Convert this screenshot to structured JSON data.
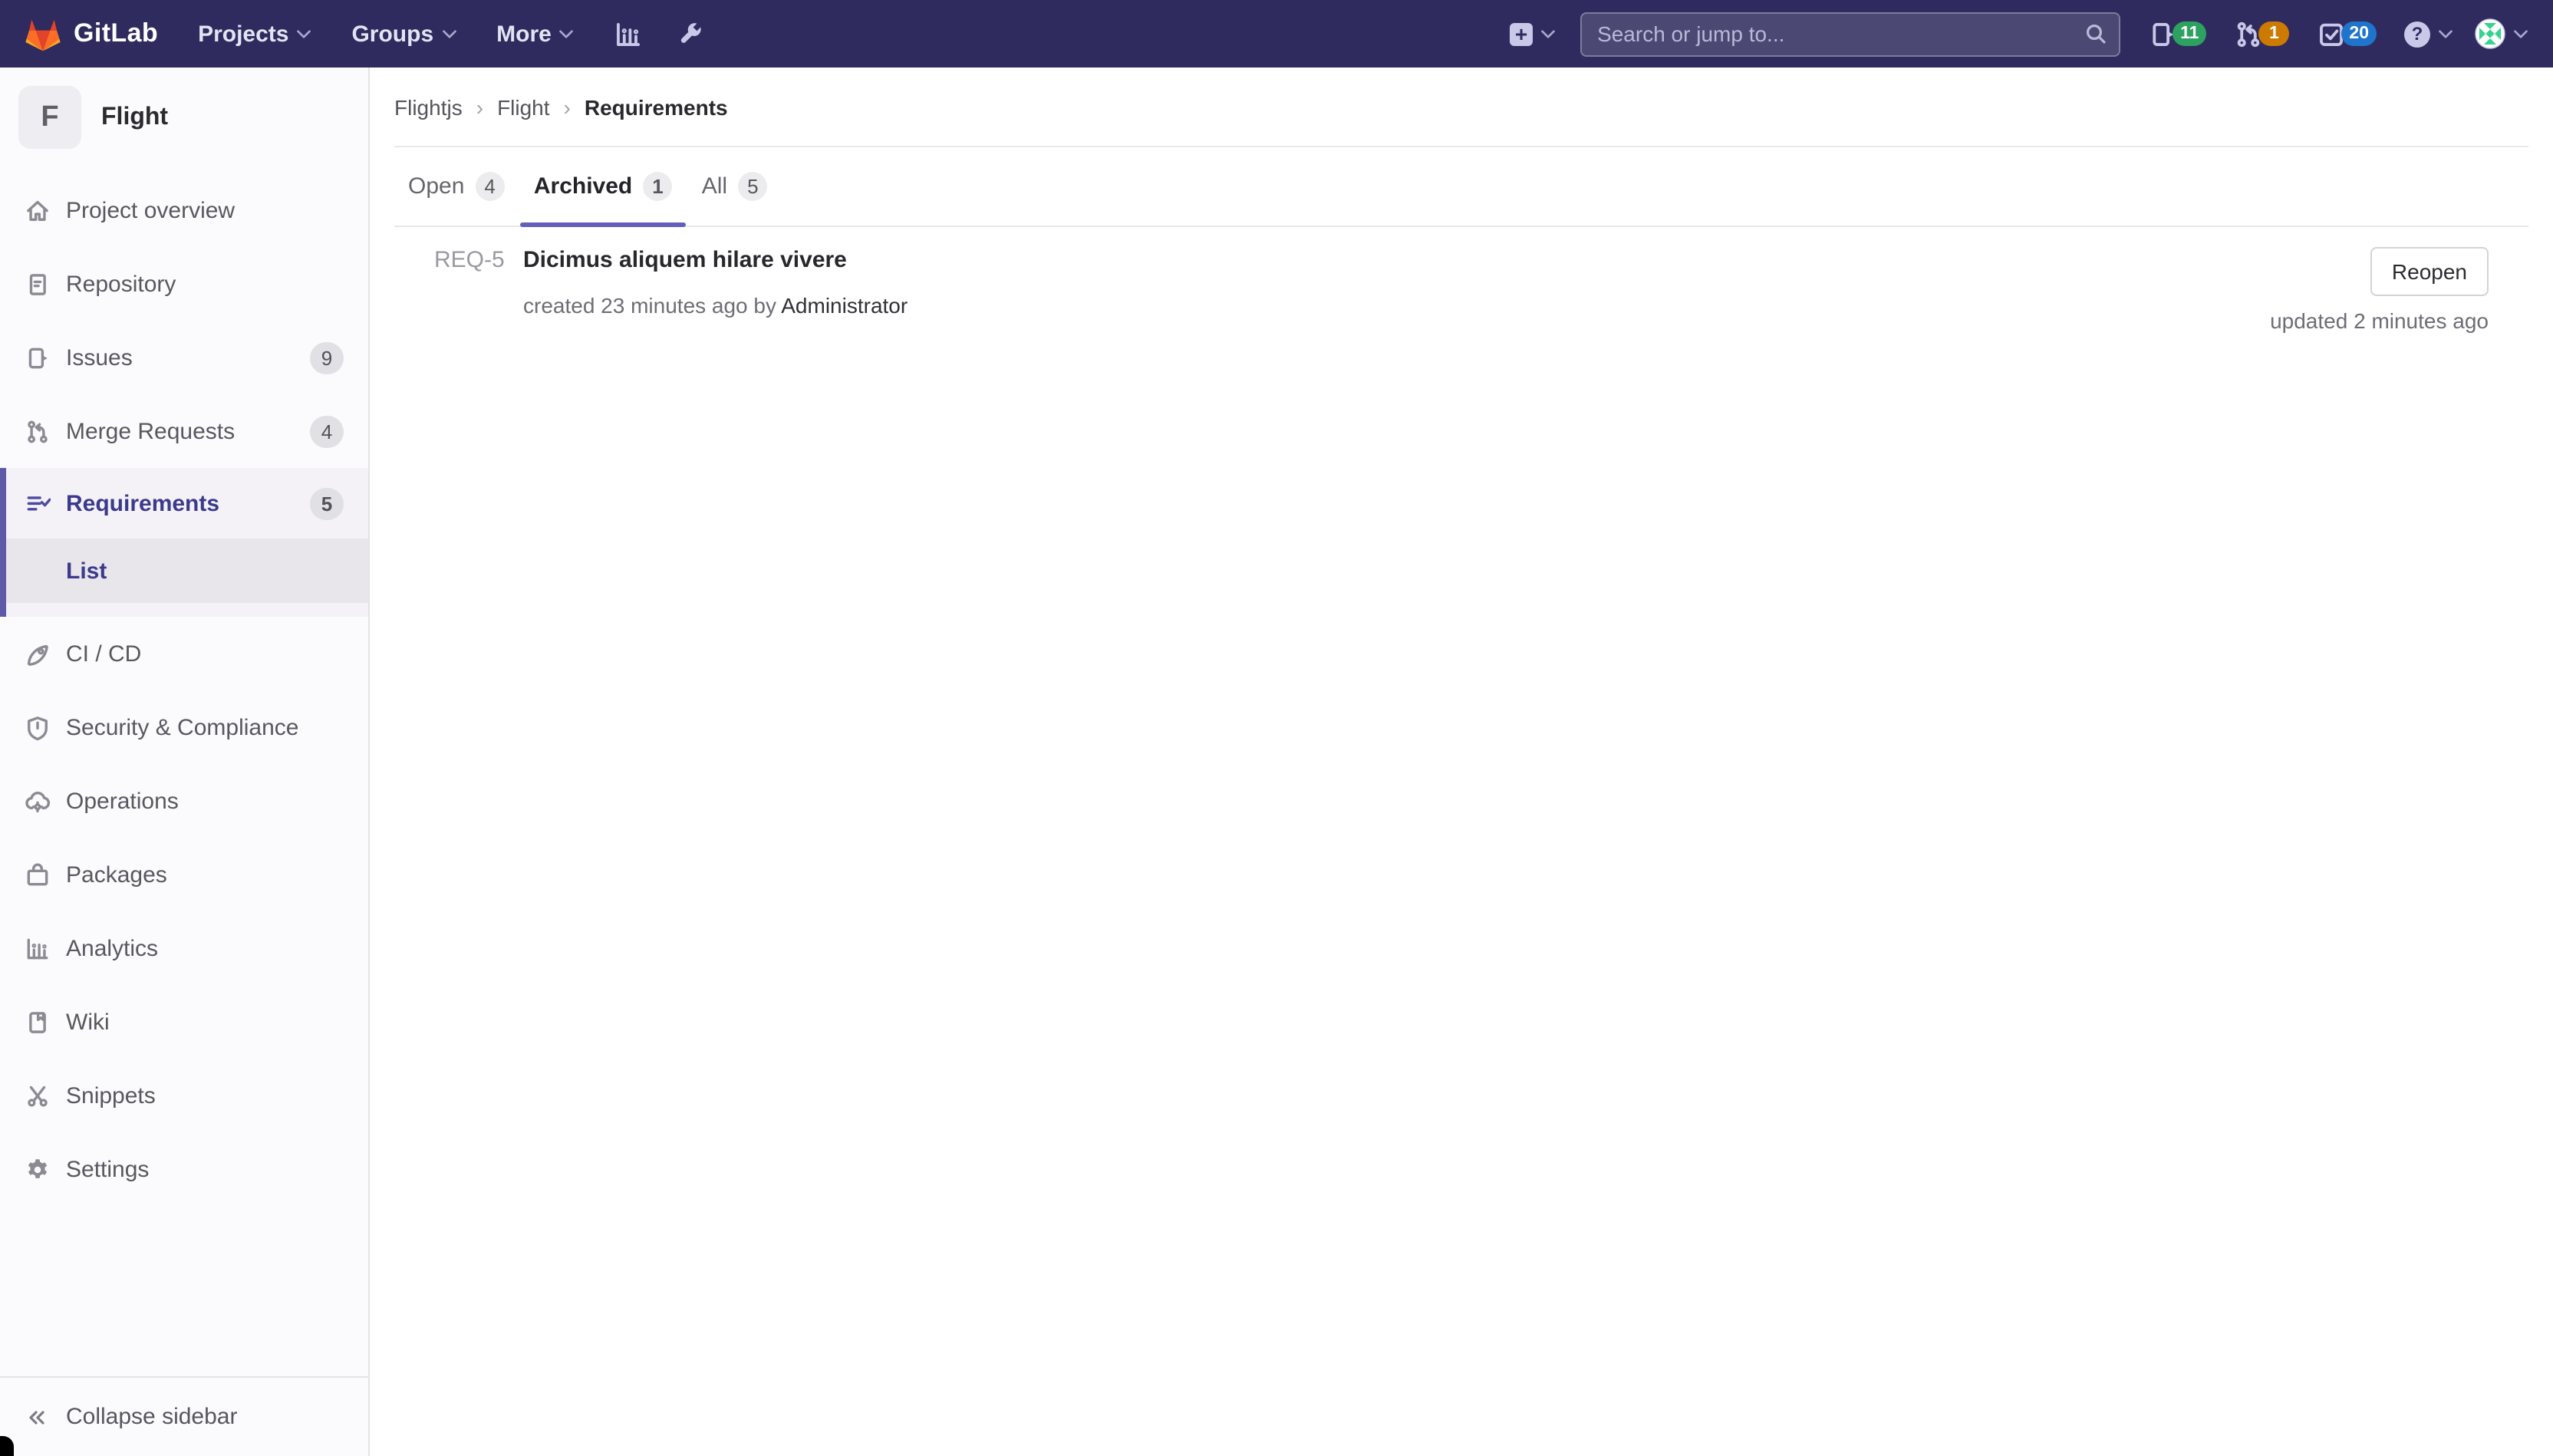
{
  "navbar": {
    "logo_text": "GitLab",
    "links": [
      {
        "label": "Projects"
      },
      {
        "label": "Groups"
      },
      {
        "label": "More"
      }
    ],
    "new_glyph": "+",
    "help_glyph": "?",
    "search": {
      "placeholder": "Search or jump to..."
    },
    "counters": {
      "issues": "11",
      "merge_requests": "1",
      "todos": "20"
    }
  },
  "sidebar": {
    "project": {
      "initial": "F",
      "name": "Flight"
    },
    "items": [
      {
        "label": "Project overview"
      },
      {
        "label": "Repository"
      },
      {
        "label": "Issues",
        "badge": "9"
      },
      {
        "label": "Merge Requests",
        "badge": "4"
      },
      {
        "label": "Requirements",
        "badge": "5"
      },
      {
        "label": "List"
      },
      {
        "label": "CI / CD"
      },
      {
        "label": "Security & Compliance"
      },
      {
        "label": "Operations"
      },
      {
        "label": "Packages"
      },
      {
        "label": "Analytics"
      },
      {
        "label": "Wiki"
      },
      {
        "label": "Snippets"
      },
      {
        "label": "Settings"
      }
    ],
    "collapse_label": "Collapse sidebar"
  },
  "breadcrumb": {
    "items": [
      "Flightjs",
      "Flight"
    ],
    "current": "Requirements",
    "separator": "›"
  },
  "tabs": [
    {
      "label": "Open",
      "count": "4"
    },
    {
      "label": "Archived",
      "count": "1"
    },
    {
      "label": "All",
      "count": "5"
    }
  ],
  "requirement": {
    "id": "REQ-5",
    "title": "Dicimus aliquem hilare vivere",
    "created_text": "created 23 minutes ago by",
    "author": "Administrator",
    "updated_text": "updated 2 minutes ago",
    "reopen_label": "Reopen"
  },
  "colors": {
    "navbar_bg": "#2f2b5e",
    "accent_indigo": "#6161bb",
    "active_border": "#5f5aa8",
    "badge_green": "#2da160",
    "badge_orange": "#cc7a00",
    "badge_blue": "#1f75cb",
    "tanuki_red": "#e24329",
    "tanuki_orange": "#fc6d26",
    "tanuki_amber": "#fca326"
  }
}
